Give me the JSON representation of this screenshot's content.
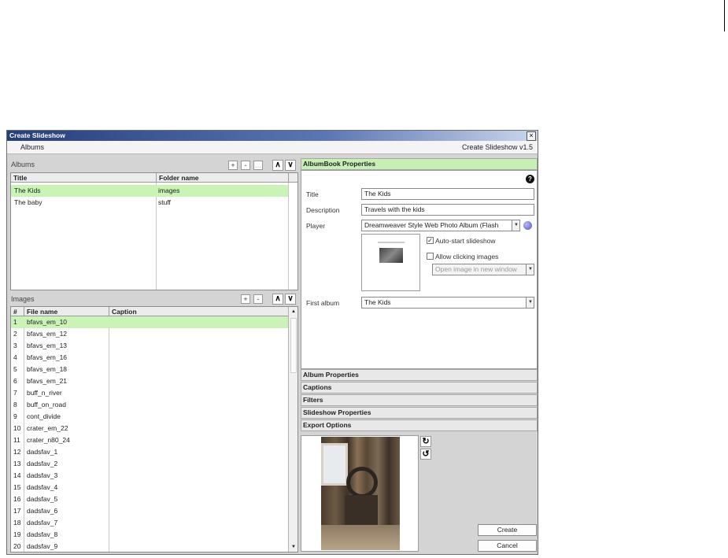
{
  "window": {
    "title": "Create Slideshow",
    "close_glyph": "×",
    "version": "Create Slideshow v1.5",
    "menu_albums": "Albums"
  },
  "albums": {
    "label": "Albums",
    "add": "+",
    "remove": "-",
    "edit": "…",
    "up": "∧",
    "down": "∨",
    "columns": [
      "Title",
      "Folder name"
    ],
    "rows": [
      {
        "title": "The Kids",
        "folder": "images",
        "selected": true
      },
      {
        "title": "The baby",
        "folder": "stuff",
        "selected": false
      }
    ]
  },
  "images": {
    "label": "Images",
    "add": "+",
    "remove": "-",
    "up": "∧",
    "down": "∨",
    "columns": [
      "#",
      "File name",
      "Caption"
    ],
    "scroll_up": "▲",
    "scroll_down": "▼",
    "rows": [
      {
        "n": "1",
        "file": "bfavs_em_10"
      },
      {
        "n": "2",
        "file": "bfavs_em_12"
      },
      {
        "n": "3",
        "file": "bfavs_em_13"
      },
      {
        "n": "4",
        "file": "bfavs_em_16"
      },
      {
        "n": "5",
        "file": "bfavs_em_18"
      },
      {
        "n": "6",
        "file": "bfavs_em_21"
      },
      {
        "n": "7",
        "file": "buff_n_river"
      },
      {
        "n": "8",
        "file": "buff_on_road"
      },
      {
        "n": "9",
        "file": "cont_divide"
      },
      {
        "n": "10",
        "file": "crater_em_22"
      },
      {
        "n": "11",
        "file": "crater_n80_24"
      },
      {
        "n": "12",
        "file": "dadsfav_1"
      },
      {
        "n": "13",
        "file": "dadsfav_2"
      },
      {
        "n": "14",
        "file": "dadsfav_3"
      },
      {
        "n": "15",
        "file": "dadsfav_4"
      },
      {
        "n": "16",
        "file": "dadsfav_5"
      },
      {
        "n": "17",
        "file": "dadsfav_6"
      },
      {
        "n": "18",
        "file": "dadsfav_7"
      },
      {
        "n": "19",
        "file": "dadsfav_8"
      },
      {
        "n": "20",
        "file": "dadsfav_9"
      }
    ]
  },
  "properties": {
    "header": "AlbumBook Properties",
    "help": "?",
    "title_label": "Title",
    "title_value": "The Kids",
    "description_label": "Description",
    "description_value": "Travels with the kids",
    "player_label": "Player",
    "player_value": "Dreamweaver Style Web Photo Album (Flash",
    "auto_start": "Auto-start slideshow",
    "allow_clicking": "Allow clicking images",
    "open_image": "Open image in new window",
    "first_album_label": "First album",
    "first_album_value": "The Kids",
    "check_glyph": "✓",
    "dropdown_glyph": "▼"
  },
  "sections": [
    "Album Properties",
    "Captions",
    "Filters",
    "Slideshow Properties",
    "Export Options"
  ],
  "preview": {
    "rotate_cw": "↻",
    "rotate_ccw": "↺"
  },
  "buttons": {
    "create": "Create",
    "cancel": "Cancel"
  }
}
